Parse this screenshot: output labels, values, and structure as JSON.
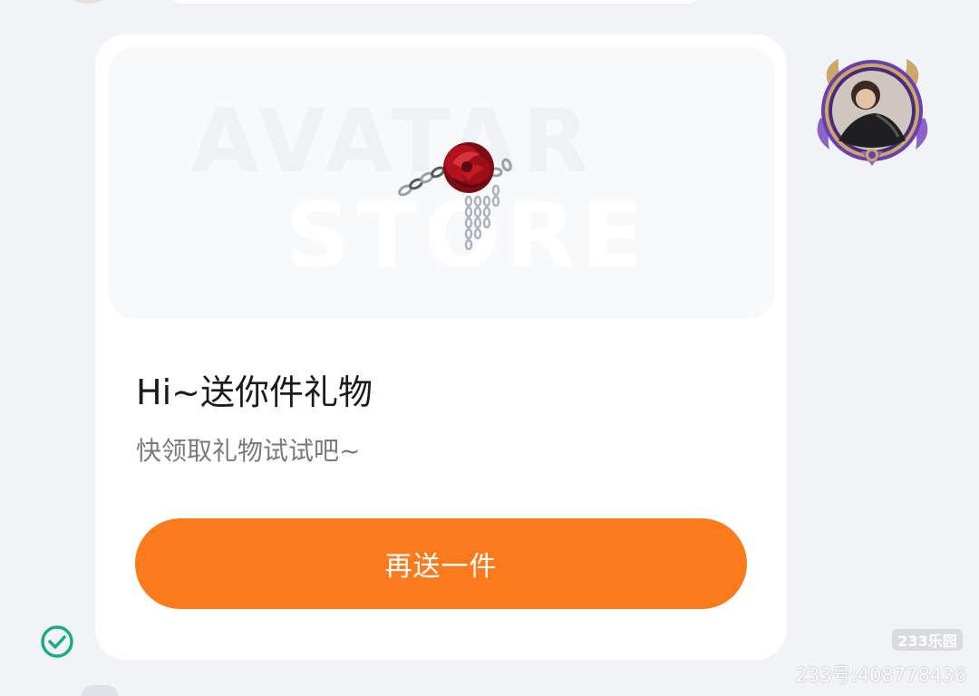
{
  "card": {
    "watermark_line1": "AVATAR",
    "watermark_line2": "STORE",
    "title": "Hi~送你件礼物",
    "subtitle": "快领取礼物试试吧~",
    "button_label": "再送一件"
  },
  "item": {
    "icon": "rose-chain-ornament-icon",
    "rose_color": "#b3121c",
    "chain_color": "#c8cbd2"
  },
  "sender": {
    "avatar_icon": "user-avatar-frame-icon",
    "frame_color": "#8b63c9"
  },
  "status": {
    "read_icon": "check-circle-icon",
    "color": "#1aad7a"
  },
  "watermark": {
    "brand": "233乐园",
    "account": "233号:408778436"
  },
  "colors": {
    "accent": "#fb7a1c",
    "background": "#f2f3f7"
  }
}
